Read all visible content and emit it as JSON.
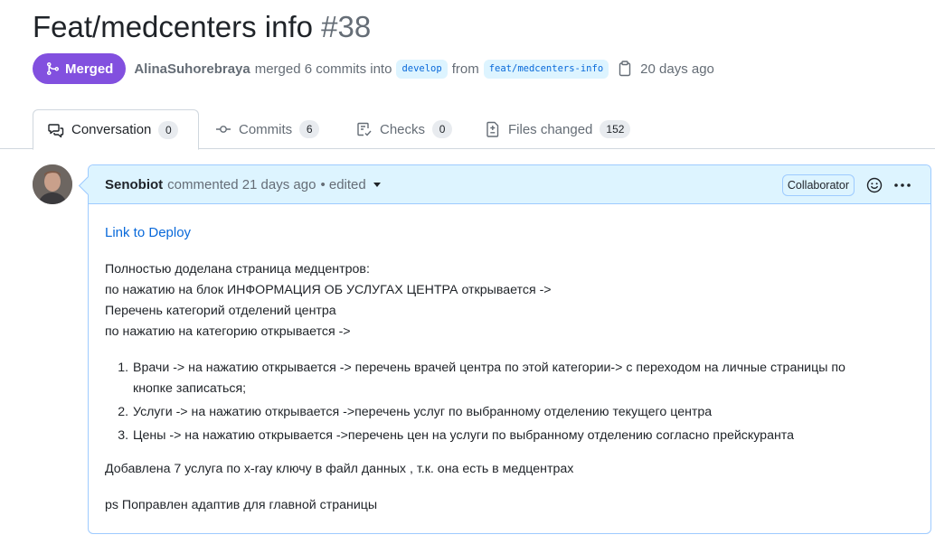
{
  "pr": {
    "title": "Feat/medcenters info",
    "number": "#38",
    "state": "Merged",
    "author": "AlinaSuhorebraya",
    "merged_text": "merged 6 commits into",
    "base_branch": "develop",
    "from_text": "from",
    "head_branch": "feat/medcenters-info",
    "time_ago": "20 days ago"
  },
  "tabs": [
    {
      "label": "Conversation",
      "count": "0",
      "icon": "comment-discussion-icon"
    },
    {
      "label": "Commits",
      "count": "6",
      "icon": "git-commit-icon"
    },
    {
      "label": "Checks",
      "count": "0",
      "icon": "checklist-icon"
    },
    {
      "label": "Files changed",
      "count": "152",
      "icon": "file-diff-icon"
    }
  ],
  "comment": {
    "author": "Senobiot",
    "action": "commented 21 days ago",
    "edited": "• edited",
    "role": "Collaborator",
    "link_text": "Link to Deploy",
    "paragraph_lines": [
      "Полностью доделана страница медцентров:",
      "по нажатию на блок ИНФОРМАЦИЯ ОБ УСЛУГАХ ЦЕНТРА открывается ->",
      "Перечень категорий отделений центра",
      "по нажатию на категорию открывается ->"
    ],
    "list_items": [
      {
        "line1": "Врачи -> на нажатию открывается -> перечень врачей центра по этой категории-> с переходом на личные страницы по",
        "line2": "кнопке записаться;"
      },
      {
        "line1": "Услуги -> на нажатию открывается ->перечень услуг по выбранному отделению текущего центра",
        "line2": ""
      },
      {
        "line1": "Цены -> на нажатию открывается ->перечень цен на услуги по выбранному отделению согласно прейскуранта",
        "line2": ""
      }
    ],
    "note": "Добавлена 7 услуга по x-ray ключу в файл данных , т.к. она есть в медцентрах",
    "ps": "ps Поправлен адаптив для главной страницы"
  },
  "colors": {
    "merged": "#8250df",
    "link": "#0969da",
    "header_bg": "#ddf4ff"
  }
}
